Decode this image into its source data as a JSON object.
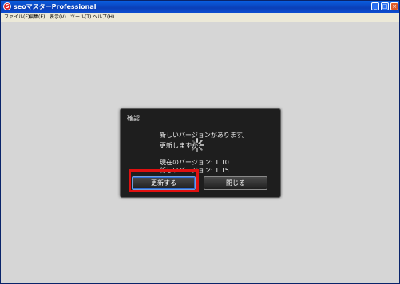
{
  "window": {
    "title": "seoマスターProfessional",
    "app_icon_letter": "S",
    "controls": {
      "minimize": "_",
      "maximize": "□",
      "close": "×"
    }
  },
  "menu": {
    "items": [
      {
        "label": "ファイル(F)"
      },
      {
        "label": "編集(E)"
      },
      {
        "label": "表示(V)"
      },
      {
        "label": "ツール(T)"
      },
      {
        "label": "ヘルプ(H)"
      }
    ]
  },
  "dialog": {
    "title": "確認",
    "message_line1": "新しいバージョンがあります。",
    "message_line2": "更新しますか？",
    "current_version": "現在のバージョン: 1.10",
    "new_version": "新しいバージョン: 1.15",
    "update_button": "更新する",
    "close_button": "閉じる"
  },
  "colors": {
    "highlight": "#e01010",
    "titlebar": "#0a4fd0",
    "dialog_bg": "#1e1e1e"
  }
}
